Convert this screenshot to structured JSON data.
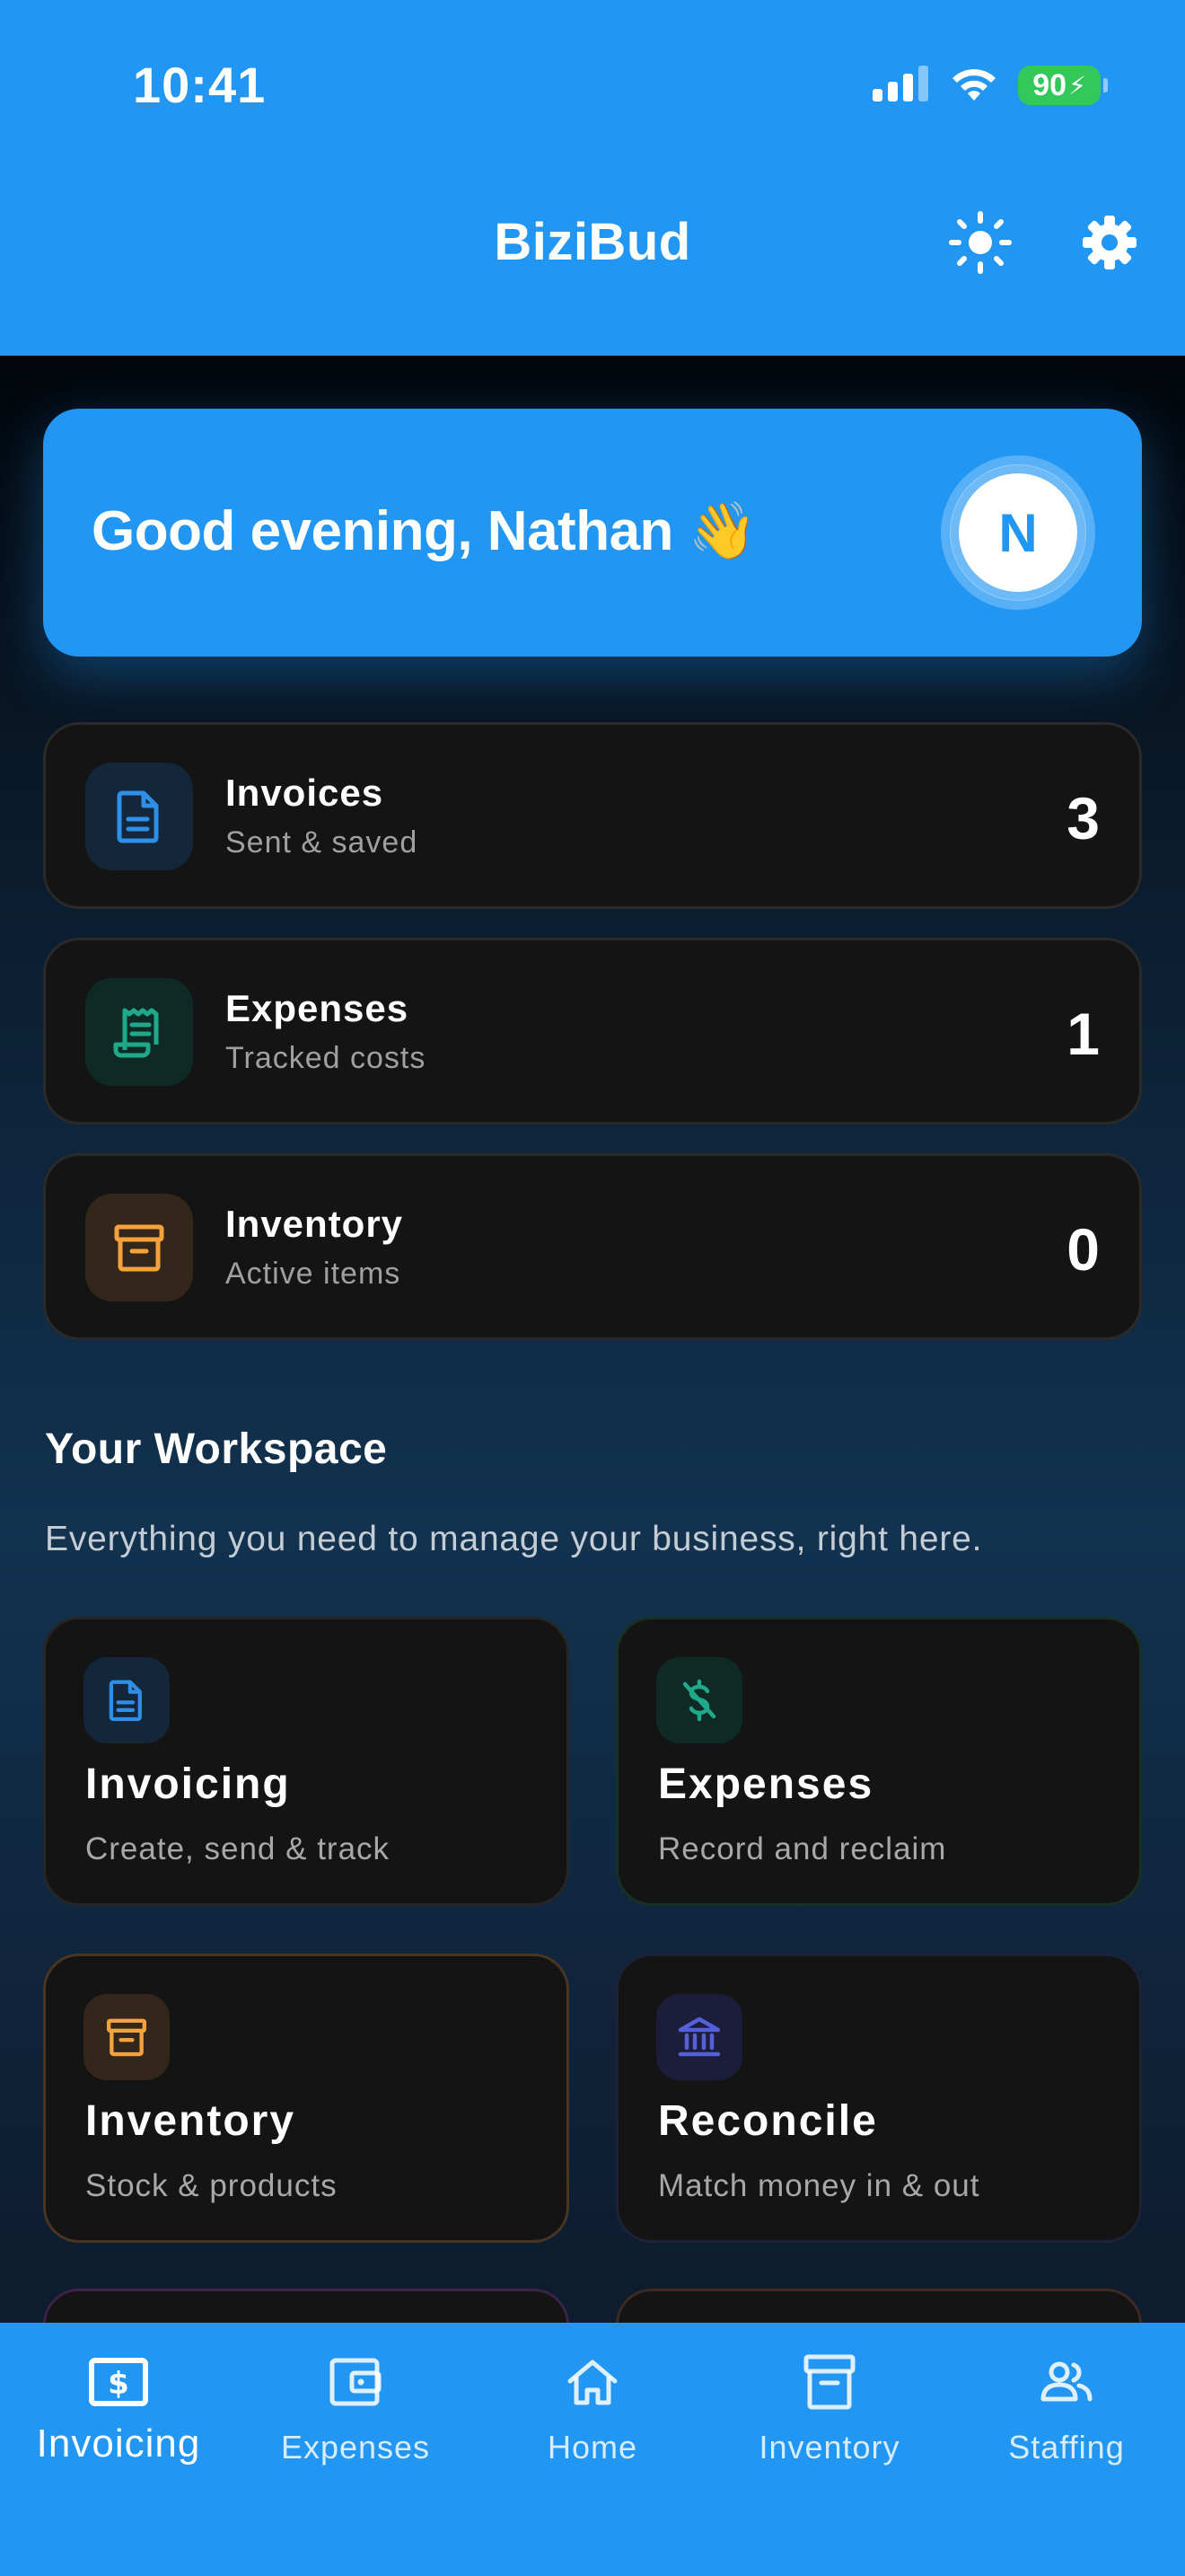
{
  "status": {
    "time": "10:41",
    "battery": "90"
  },
  "header": {
    "title": "BiziBud"
  },
  "greeting": {
    "text": "Good evening, Nathan 👋",
    "avatar_initial": "N"
  },
  "stats": [
    {
      "title": "Invoices",
      "subtitle": "Sent & saved",
      "count": "3",
      "icon": "document-icon"
    },
    {
      "title": "Expenses",
      "subtitle": "Tracked costs",
      "count": "1",
      "icon": "receipt-icon"
    },
    {
      "title": "Inventory",
      "subtitle": "Active items",
      "count": "0",
      "icon": "archive-icon"
    }
  ],
  "workspace": {
    "title": "Your Workspace",
    "description": "Everything you need to manage your business, right here.",
    "tiles": [
      {
        "title": "Invoicing",
        "subtitle": "Create, send & track",
        "icon": "document-icon"
      },
      {
        "title": "Expenses",
        "subtitle": "Record and reclaim",
        "icon": "dollar-slash-icon"
      },
      {
        "title": "Inventory",
        "subtitle": "Stock & products",
        "icon": "archive-icon"
      },
      {
        "title": "Reconcile",
        "subtitle": "Match money in & out",
        "icon": "bank-icon"
      }
    ]
  },
  "nav": [
    {
      "label": "Invoicing",
      "icon": "dollar-bill-icon",
      "active": true
    },
    {
      "label": "Expenses",
      "icon": "wallet-icon"
    },
    {
      "label": "Home",
      "icon": "home-icon"
    },
    {
      "label": "Inventory",
      "icon": "archive-icon"
    },
    {
      "label": "Staffing",
      "icon": "people-icon"
    }
  ],
  "colors": {
    "primary": "#2196f3",
    "invoice_accent": "#2f8fe6",
    "expense_accent": "#1fa98a",
    "inventory_accent": "#f5a23c",
    "reconcile_accent": "#5560d8"
  }
}
